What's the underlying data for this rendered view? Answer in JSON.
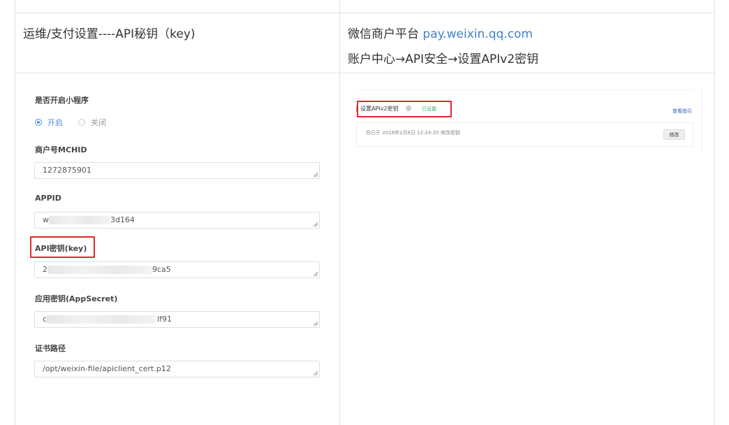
{
  "row1": {
    "left": "运维/支付设置----API秘钥（key)",
    "right_line1_prefix": "微信商户平台 ",
    "right_line1_link": "pay.weixin.qq.com",
    "right_line2": "账户中心→API安全→设置APIv2密钥"
  },
  "form": {
    "miniapp_label": "是否开启小程序",
    "radio_on": "开启",
    "radio_off": "关闭",
    "mchid_label": "商户号MCHID",
    "mchid_value": "1272875901",
    "appid_label": "APPID",
    "appid_prefix": "w",
    "appid_suffix": "3d164",
    "apikey_label": "API密钥(key)",
    "apikey_prefix": "2",
    "apikey_suffix": "9ca5",
    "appsecret_label": "应用密钥(AppSecret)",
    "appsecret_prefix": "c",
    "appsecret_suffix": "lf91",
    "cert_label": "证书路径",
    "cert_value": "/opt/weixin-file/apiclient_cert.p12"
  },
  "shot": {
    "title": "设置APIv2密钥",
    "status": "已设置",
    "guide_link": "查看指引",
    "info": "你已于 2018年2月8日 12:24:20 修改密钥",
    "modify_button": "修改"
  },
  "colors": {
    "border": "#dfe2e5",
    "link": "#4183c4",
    "radio_active": "#4a90e2",
    "highlight_red": "#e0262e",
    "status_green": "#3cb371"
  }
}
